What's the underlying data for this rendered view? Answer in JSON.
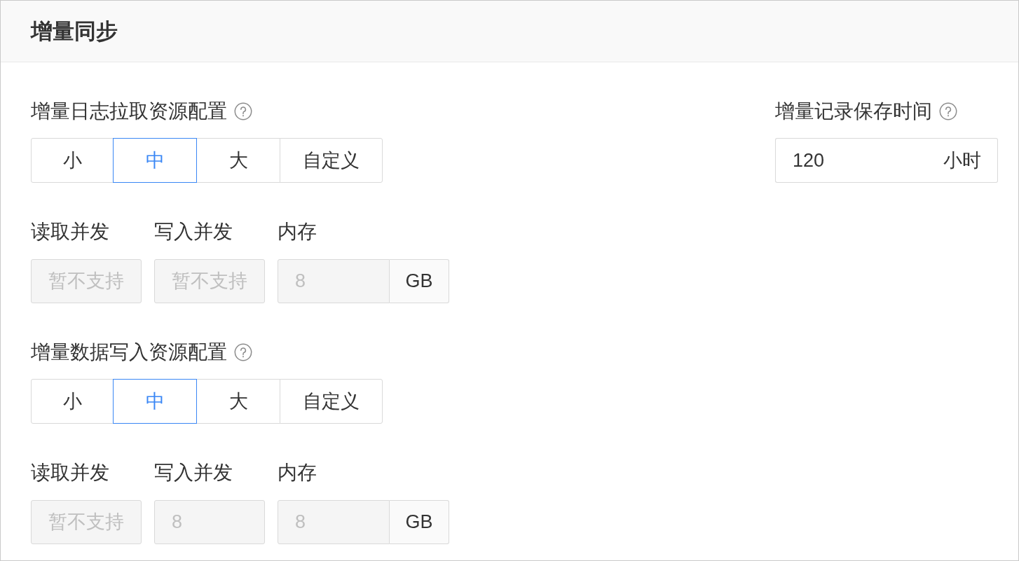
{
  "header": {
    "title": "增量同步"
  },
  "sections": [
    {
      "label": "增量日志拉取资源配置",
      "options": [
        {
          "label": "小",
          "selected": false
        },
        {
          "label": "中",
          "selected": true
        },
        {
          "label": "大",
          "selected": false
        },
        {
          "label": "自定义",
          "selected": false
        }
      ],
      "fields": [
        {
          "kind": "text",
          "label": "读取并发",
          "placeholder": "暂不支持",
          "disabled": true
        },
        {
          "kind": "text",
          "label": "写入并发",
          "placeholder": "暂不支持",
          "disabled": true
        },
        {
          "kind": "unit",
          "label": "内存",
          "value": "8",
          "unit": "GB",
          "disabled": true
        }
      ]
    },
    {
      "label": "增量数据写入资源配置",
      "options": [
        {
          "label": "小",
          "selected": false
        },
        {
          "label": "中",
          "selected": true
        },
        {
          "label": "大",
          "selected": false
        },
        {
          "label": "自定义",
          "selected": false
        }
      ],
      "fields": [
        {
          "kind": "text",
          "label": "读取并发",
          "placeholder": "暂不支持",
          "disabled": true
        },
        {
          "kind": "text",
          "label": "写入并发",
          "value": "8",
          "disabled": true
        },
        {
          "kind": "unit",
          "label": "内存",
          "value": "8",
          "unit": "GB",
          "disabled": true
        }
      ]
    }
  ],
  "retention": {
    "label": "增量记录保存时间",
    "value": "120",
    "unit": "小时"
  }
}
